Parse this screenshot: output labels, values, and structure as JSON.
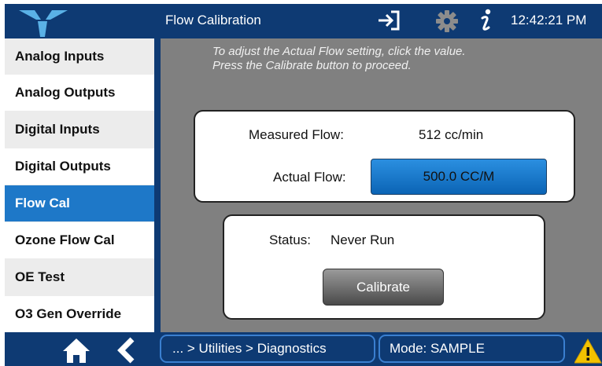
{
  "header": {
    "title": "Flow Calibration",
    "clock": "12:42:21 PM",
    "icons": [
      "logo-icon",
      "login-icon",
      "gear-icon",
      "info-icon"
    ]
  },
  "sidebar": {
    "items": [
      {
        "label": "Analog Inputs",
        "active": false
      },
      {
        "label": "Analog Outputs",
        "active": false
      },
      {
        "label": "Digital Inputs",
        "active": false
      },
      {
        "label": "Digital Outputs",
        "active": false
      },
      {
        "label": "Flow Cal",
        "active": true
      },
      {
        "label": "Ozone Flow Cal",
        "active": false
      },
      {
        "label": "OE Test",
        "active": false
      },
      {
        "label": "O3 Gen Override",
        "active": false
      }
    ]
  },
  "main": {
    "instructions": [
      "To adjust the Actual Flow setting, click the value.",
      "Press the Calibrate button to proceed."
    ],
    "measured_flow_label": "Measured Flow:",
    "measured_flow_value": "512 cc/min",
    "actual_flow_label": "Actual Flow:",
    "actual_flow_value": "500.0 CC/M",
    "status_label": "Status:",
    "status_value": "Never Run",
    "calibrate_label": "Calibrate"
  },
  "footer": {
    "breadcrumb": "... > Utilities > Diagnostics",
    "mode": "Mode: SAMPLE",
    "icons": [
      "home-icon",
      "back-icon",
      "warning-icon"
    ]
  },
  "colors": {
    "header_bg": "#0e3a73",
    "accent": "#1e78c8",
    "panel_bg": "#808080",
    "warning": "#f2c200"
  }
}
